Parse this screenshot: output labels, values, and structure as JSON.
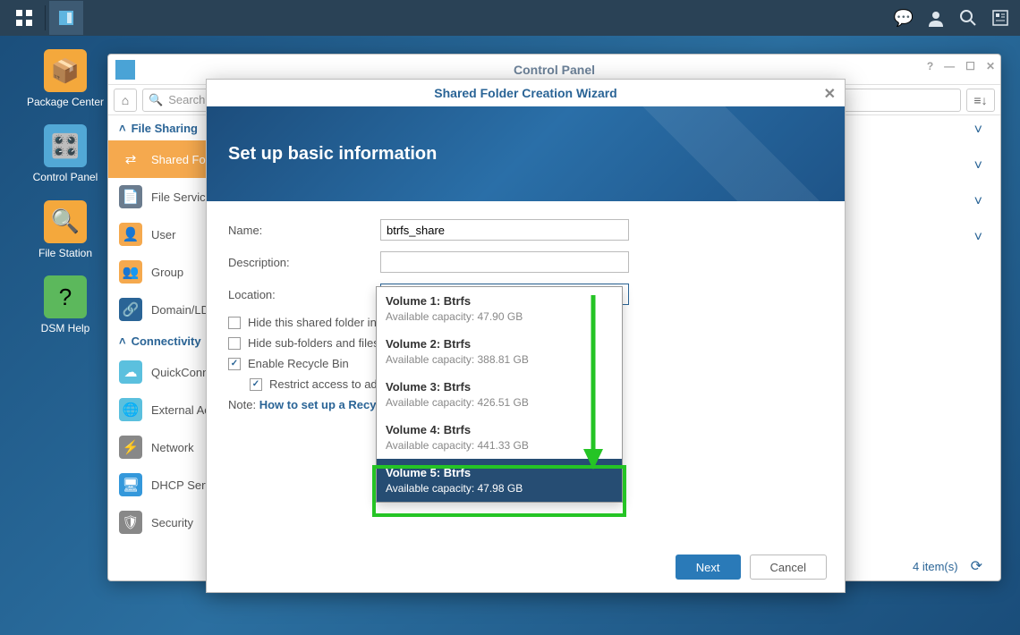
{
  "topbar": {
    "speech_icon": "speech-icon"
  },
  "desktop": {
    "package_center": "Package Center",
    "control_panel": "Control Panel",
    "file_station": "File Station",
    "dsm_help": "DSM Help"
  },
  "window": {
    "title": "Control Panel",
    "search_placeholder": "Search",
    "footer_items": "4 item(s)"
  },
  "sidebar": {
    "section1": "File Sharing",
    "section2": "Connectivity",
    "items": [
      "Shared Folder",
      "File Services",
      "User",
      "Group",
      "Domain/LDAP",
      "QuickConnect",
      "External Access",
      "Network",
      "DHCP Server",
      "Security"
    ]
  },
  "wizard": {
    "title": "Shared Folder Creation Wizard",
    "heading": "Set up basic information",
    "labels": {
      "name": "Name:",
      "description": "Description:",
      "location": "Location:"
    },
    "name_value": "btrfs_share",
    "description_value": "",
    "location_prefix": "Volume 1:",
    "location_fs": "Btrfs",
    "chk_hide1": "Hide this shared folder in \"My Network Places\"",
    "chk_hide2": "Hide sub-folders and files from users without permissions",
    "chk_recycle": "Enable Recycle Bin",
    "chk_restrict": "Restrict access to administrators only",
    "note_prefix": "Note: ",
    "note_link": "How to set up a Recycle Bin emptying schedule?",
    "next": "Next",
    "cancel": "Cancel"
  },
  "volumes": [
    {
      "name": "Volume 1: Btrfs",
      "cap": "Available capacity: 47.90 GB"
    },
    {
      "name": "Volume 2: Btrfs",
      "cap": "Available capacity: 388.81 GB"
    },
    {
      "name": "Volume 3: Btrfs",
      "cap": "Available capacity: 426.51 GB"
    },
    {
      "name": "Volume 4: Btrfs",
      "cap": "Available capacity: 441.33 GB"
    },
    {
      "name": "Volume 5: Btrfs",
      "cap": "Available capacity: 47.98 GB"
    }
  ]
}
